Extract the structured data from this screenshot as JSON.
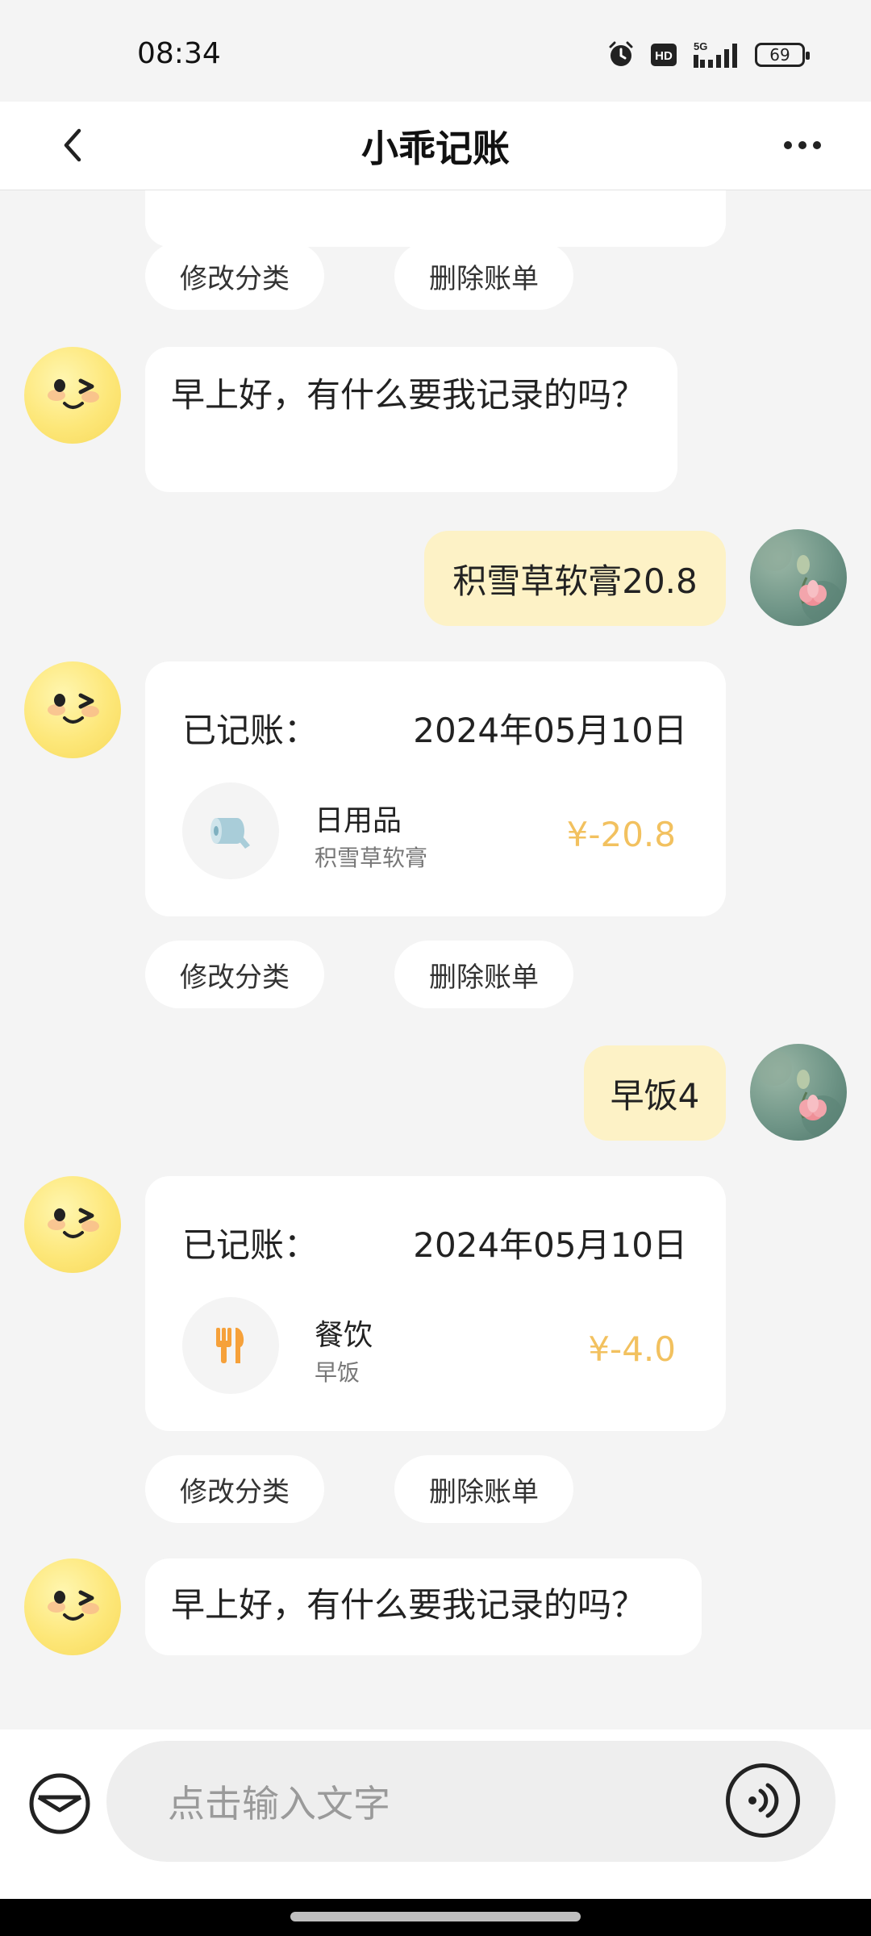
{
  "status_bar": {
    "time": "08:34",
    "network": "5G",
    "hd": "HD",
    "battery": "69"
  },
  "header": {
    "title": "小乖记账"
  },
  "actions": {
    "edit_category": "修改分类",
    "delete_bill": "删除账单"
  },
  "messages": {
    "greeting_1": "早上好，有什么要我记录的吗？",
    "user_1": "积雪草软膏20.8",
    "user_2": "早饭4",
    "greeting_2": "早上好，有什么要我记录的吗？"
  },
  "records": [
    {
      "label": "已记账：",
      "date": "2024年05月10日",
      "category": "日用品",
      "note": "积雪草软膏",
      "amount": "¥-20.8",
      "icon": "tissue-roll-icon"
    },
    {
      "label": "已记账：",
      "date": "2024年05月10日",
      "category": "餐饮",
      "note": "早饭",
      "amount": "¥-4.0",
      "icon": "fork-knife-icon"
    }
  ],
  "input": {
    "placeholder": "点击输入文字"
  },
  "colors": {
    "accent": "#f2c15f",
    "user_bubble": "#fdf2c6",
    "background": "#f4f4f4"
  }
}
